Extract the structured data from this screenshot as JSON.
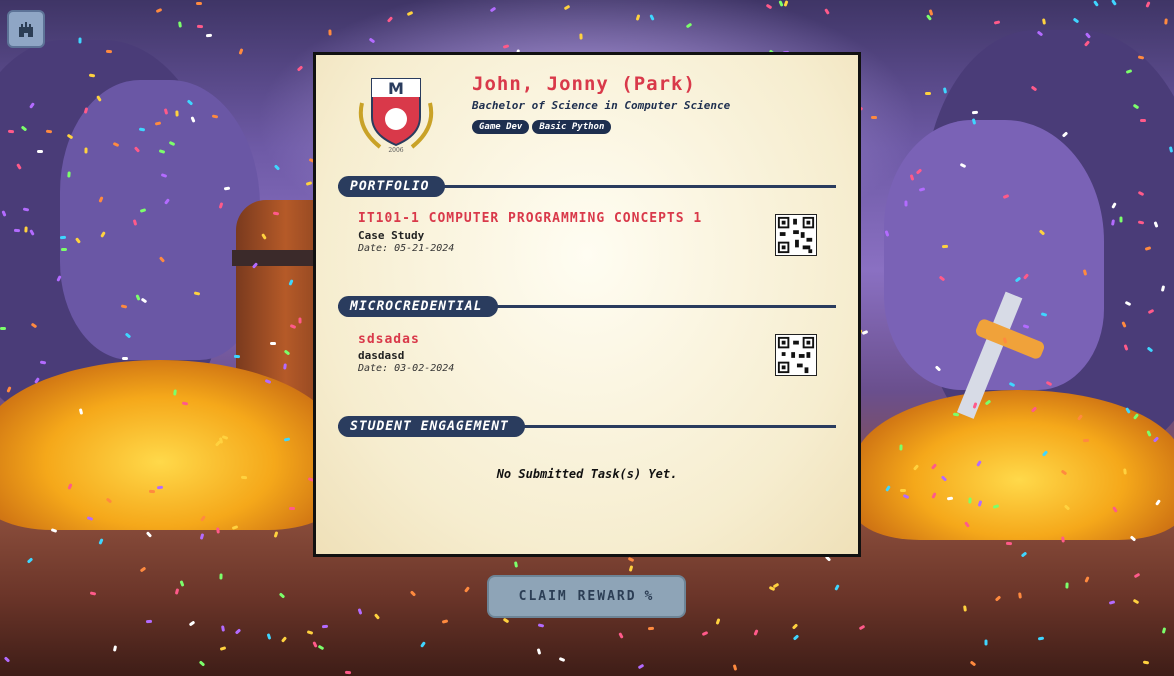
{
  "student": {
    "name": "John, Jonny (Park)",
    "degree": "Bachelor of Science in Computer Science",
    "tags": [
      "Game Dev",
      "Basic Python"
    ]
  },
  "crest": {
    "monogram": "M",
    "year": "2006"
  },
  "sections": {
    "portfolio": {
      "heading": "PORTFOLIO",
      "item": {
        "title": "IT101-1 COMPUTER PROGRAMMING CONCEPTS 1",
        "type": "Case Study",
        "date": "Date: 05-21-2024"
      }
    },
    "microcredential": {
      "heading": "MICROCREDENTIAL",
      "item": {
        "title": "sdsadas",
        "type": "dasdasd",
        "date": "Date: 03-02-2024"
      }
    },
    "engagement": {
      "heading": "STUDENT ENGAGEMENT",
      "empty_message": "No Submitted Task(s) Yet."
    }
  },
  "actions": {
    "claim_label": "CLAIM REWARD",
    "claim_icon": "percent-icon"
  },
  "nav": {
    "home_icon": "castle-icon"
  },
  "colors": {
    "accent": "#d9394a",
    "navy": "#2a3c5e",
    "card": "#f6edcf"
  }
}
